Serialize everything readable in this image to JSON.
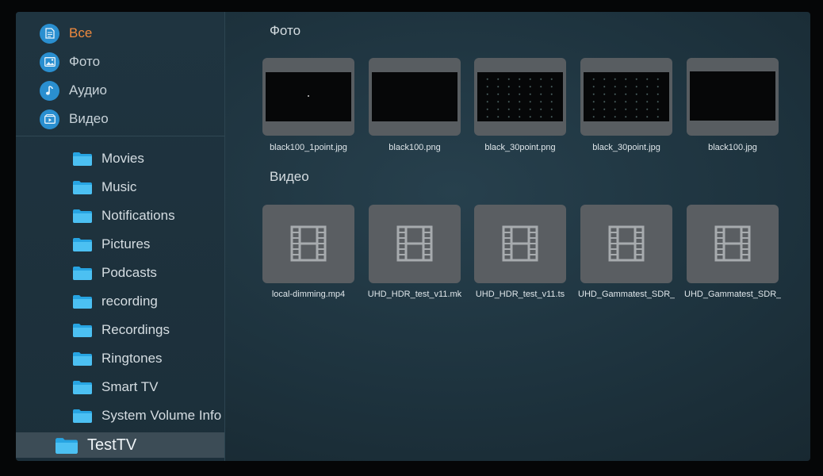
{
  "sidebar": {
    "categories": [
      {
        "label": "Все",
        "icon": "document-icon"
      },
      {
        "label": "Фото",
        "icon": "image-icon"
      },
      {
        "label": "Аудио",
        "icon": "music-note-icon"
      },
      {
        "label": "Видео",
        "icon": "video-icon"
      }
    ],
    "active_category": "Все",
    "folders": [
      {
        "label": "Movies"
      },
      {
        "label": "Music"
      },
      {
        "label": "Notifications"
      },
      {
        "label": "Pictures"
      },
      {
        "label": "Podcasts"
      },
      {
        "label": "recording"
      },
      {
        "label": "Recordings"
      },
      {
        "label": "Ringtones"
      },
      {
        "label": "Smart TV"
      },
      {
        "label": "System Volume Info"
      },
      {
        "label": "TestTV"
      }
    ],
    "selected_folder": "TestTV"
  },
  "main": {
    "photo_section": {
      "title": "Фото",
      "items": [
        {
          "name": "black100_1point.jpg",
          "thumb": "single-point"
        },
        {
          "name": "black100.png",
          "thumb": "black"
        },
        {
          "name": "black_30point.png",
          "thumb": "dot-grid"
        },
        {
          "name": "black_30point.jpg",
          "thumb": "dot-grid"
        },
        {
          "name": "black100.jpg",
          "thumb": "black"
        }
      ]
    },
    "video_section": {
      "title": "Видео",
      "items": [
        {
          "name": "local-dimming.mp4"
        },
        {
          "name": "UHD_HDR_test_v11.mk"
        },
        {
          "name": "UHD_HDR_test_v11.ts"
        },
        {
          "name": "UHD_Gammatest_SDR_"
        },
        {
          "name": "UHD_Gammatest_SDR_"
        }
      ]
    }
  },
  "colors": {
    "accent": "#f08a3e",
    "category_icon_bg": "#2a8fd0",
    "folder": "#3bb3ec",
    "selected_row": "#3c4c56"
  }
}
